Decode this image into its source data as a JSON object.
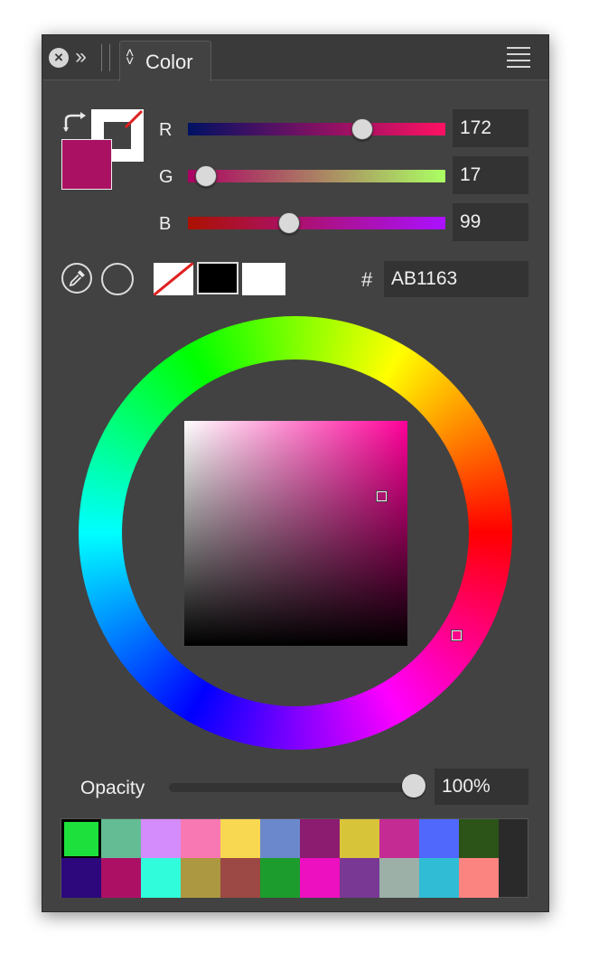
{
  "titlebar": {
    "close_icon": "close-icon",
    "expand_icon": "double-chevron-right-icon",
    "tab_label": "Color",
    "menu_icon": "hamburger-menu-icon"
  },
  "channels": [
    {
      "label": "R",
      "value": "172",
      "fraction": 0.674
    },
    {
      "label": "G",
      "value": "17",
      "fraction": 0.067
    },
    {
      "label": "B",
      "value": "99",
      "fraction": 0.388
    }
  ],
  "current_fill_color": "#AB1163",
  "hex": {
    "symbol": "#",
    "value": "AB1163"
  },
  "quick_swatches": [
    "none",
    "#000000",
    "#FFFFFF"
  ],
  "tools": {
    "eyedropper_icon": "eyedropper-icon",
    "circle_icon": "circle-icon",
    "swap_icon": "swap-arrow-icon"
  },
  "opacity": {
    "label": "Opacity",
    "value": "100%",
    "fraction": 1.0
  },
  "palette": [
    [
      "#1EE03C",
      "#64BC94",
      "#D48CFC",
      "#F878B4",
      "#F8D850",
      "#6C88CC",
      "#8C1C70",
      "#D8C438",
      "#C42C94",
      "#5068FC",
      "#2C5418"
    ],
    [
      "#2C087C",
      "#AC1064",
      "#30FCDC",
      "#AC9840",
      "#9C4844",
      "#1C9C2C",
      "#EC10C0",
      "#783894",
      "#9CB0A8",
      "#30BCD4",
      "#FC8480"
    ]
  ]
}
